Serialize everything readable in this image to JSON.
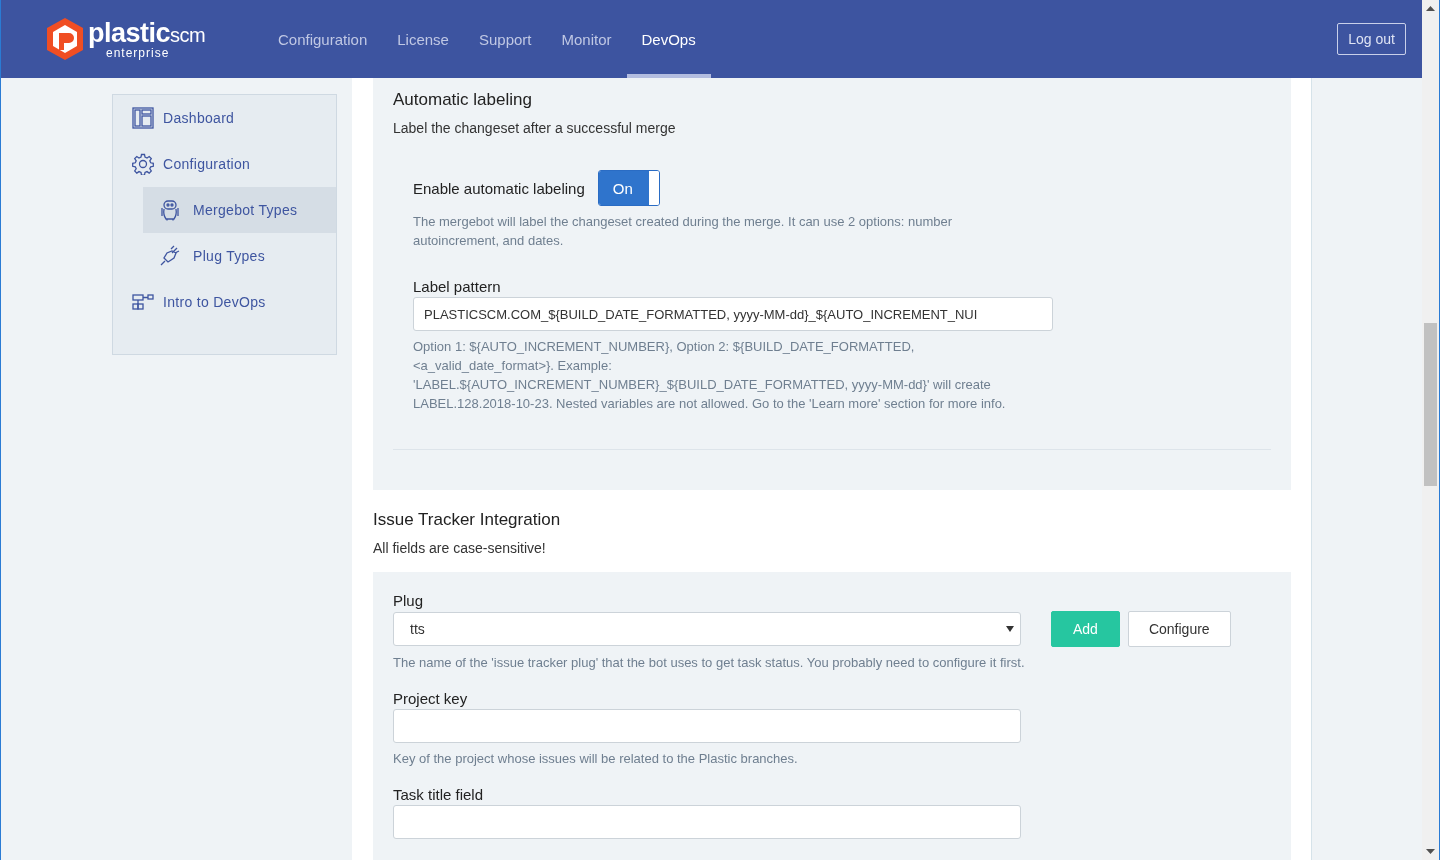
{
  "logo": {
    "name": "plastic",
    "suffix": "scm",
    "sub": "enterprise"
  },
  "nav": [
    {
      "label": "Configuration",
      "selected": false
    },
    {
      "label": "License",
      "selected": false
    },
    {
      "label": "Support",
      "selected": false
    },
    {
      "label": "Monitor",
      "selected": false
    },
    {
      "label": "DevOps",
      "selected": true
    }
  ],
  "logout": "Log out",
  "sidebar": {
    "items": [
      {
        "label": "Dashboard",
        "selected": false
      },
      {
        "label": "Configuration",
        "selected": false,
        "children": [
          {
            "label": "Mergebot Types",
            "selected": true
          },
          {
            "label": "Plug Types",
            "selected": false
          }
        ]
      },
      {
        "label": "Intro to DevOps",
        "selected": false
      }
    ]
  },
  "auto_labeling": {
    "title": "Automatic labeling",
    "description": "Label the changeset after a successful merge",
    "toggle": {
      "label": "Enable automatic labeling",
      "on": true,
      "text": "On"
    },
    "toggle_help": "The mergebot will label the changeset created during the merge. It can use 2 options: number autoincrement, and dates.",
    "pattern": {
      "label": "Label pattern",
      "value": "PLASTICSCM.COM_${BUILD_DATE_FORMATTED, yyyy-MM-dd}_${AUTO_INCREMENT_NUI",
      "help": "Option 1: ${AUTO_INCREMENT_NUMBER}, Option 2: ${BUILD_DATE_FORMATTED, <a_valid_date_format>}. Example: 'LABEL.${AUTO_INCREMENT_NUMBER}_${BUILD_DATE_FORMATTED, yyyy-MM-dd}' will create LABEL.128.2018-10-23. Nested variables are not allowed. Go to the 'Learn more' section for more info."
    }
  },
  "issue_tracker": {
    "title": "Issue Tracker Integration",
    "description": "All fields are case-sensitive!",
    "fields": [
      {
        "kind": "select",
        "label": "Plug",
        "value": "tts",
        "help": "The name of the 'issue tracker plug' that the bot uses to get task status. You probably need to configure it first.",
        "buttons": [
          {
            "label": "Add",
            "kind": "primary"
          },
          {
            "label": "Configure",
            "kind": "default"
          }
        ]
      },
      {
        "kind": "text",
        "label": "Project key",
        "help": "Key of the project whose issues will be related to the Plastic branches."
      },
      {
        "kind": "text",
        "label": "Task title field"
      }
    ]
  }
}
